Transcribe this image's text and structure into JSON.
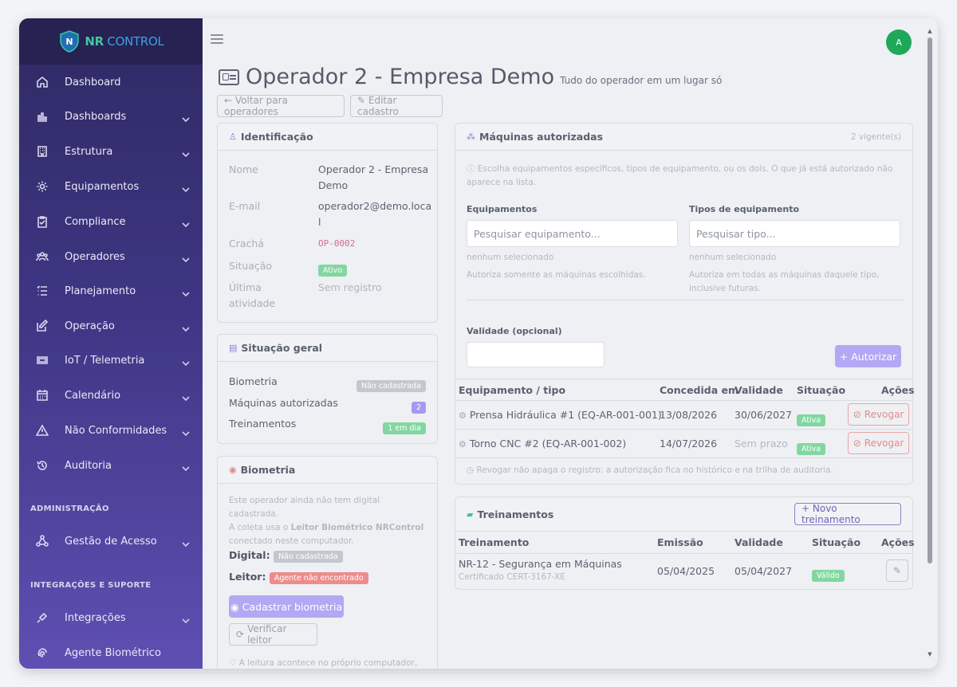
{
  "brand": {
    "nr": "NR",
    "control": "CONTROL"
  },
  "sidebar": {
    "items": [
      {
        "label": "Dashboard",
        "icon": "home-icon"
      },
      {
        "label": "Dashboards",
        "icon": "bar-chart-icon"
      },
      {
        "label": "Estrutura",
        "icon": "building-icon"
      },
      {
        "label": "Equipamentos",
        "icon": "gear-icon"
      },
      {
        "label": "Compliance",
        "icon": "clipboard-check-icon"
      },
      {
        "label": "Operadores",
        "icon": "people-icon"
      },
      {
        "label": "Planejamento",
        "icon": "list-icon"
      },
      {
        "label": "Operação",
        "icon": "edit-icon"
      },
      {
        "label": "IoT / Telemetria",
        "icon": "device-icon"
      },
      {
        "label": "Calendário",
        "icon": "calendar-icon"
      },
      {
        "label": "Não Conformidades",
        "icon": "warning-icon"
      },
      {
        "label": "Auditoria",
        "icon": "history-icon"
      }
    ],
    "section_admin": "ADMINISTRAÇÃO",
    "admin_items": [
      {
        "label": "Gestão de Acesso",
        "icon": "diagram-icon"
      }
    ],
    "section_integ": "INTEGRAÇÕES E SUPORTE",
    "integ_items": [
      {
        "label": "Integrações",
        "icon": "plug-icon"
      },
      {
        "label": "Agente Biométrico",
        "icon": "fingerprint-icon"
      }
    ]
  },
  "topbar": {
    "avatar": "A"
  },
  "page": {
    "title": "Operador 2 - Empresa Demo",
    "subtitle": "Tudo do operador em um lugar só",
    "back_button": "← Voltar para operadores",
    "edit_button": "✎ Editar cadastro"
  },
  "identificacao": {
    "title": "Identificação",
    "nome_label": "Nome",
    "nome_l1": "Operador 2 - Empresa",
    "nome_l2": "Demo",
    "email_label": "E-mail",
    "email_l1": "operador2@demo.loca",
    "email_l2": "l",
    "cracha_label": "Crachá",
    "cracha": "OP-0002",
    "situacao_label": "Situação",
    "situacao": "Ativo",
    "ultima_l1": "Última",
    "ultima_l2": "atividade",
    "ultima": "Sem registro"
  },
  "situacao_geral": {
    "title": "Situação geral",
    "rows": [
      {
        "label": "Biometria",
        "badge": "Não cadastrada"
      },
      {
        "label": "Máquinas autorizadas",
        "badge": "2"
      },
      {
        "label": "Treinamentos",
        "badge": "1 em dia"
      }
    ]
  },
  "biometria": {
    "title": "Biometria",
    "text_l1": "Este operador ainda não tem digital cadastrada.",
    "text_l2a": "A coleta usa o ",
    "text_l2b": "Leitor Biométrico NRControl",
    "text_l3": "conectado neste computador.",
    "digital_label": "Digital:",
    "digital_badge": "Não cadastrada",
    "leitor_label": "Leitor:",
    "leitor_badge": "Agente não encontrado",
    "cadastrar_button": "Cadastrar biometria",
    "verificar_button": "Verificar leitor",
    "footer": "♡ A leitura acontece no próprio computador,"
  },
  "maquinas": {
    "title": "Máquinas autorizadas",
    "count": "2 vigente(s)",
    "info_l1": "ⓘ Escolha equipamentos específicos, tipos de equipamento, ou os dois. O que já está autorizado não",
    "info_l2": "aparece na lista.",
    "equip_label": "Equipamentos",
    "equip_placeholder": "Pesquisar equipamento...",
    "equip_none": "nenhum selecionado",
    "equip_help": "Autoriza somente as máquinas escolhidas.",
    "tipos_label": "Tipos de equipamento",
    "tipos_placeholder": "Pesquisar tipo...",
    "tipos_none": "nenhum selecionado",
    "tipos_help_l1": "Autoriza em todas as máquinas daquele tipo,",
    "tipos_help_l2": "inclusive futuras.",
    "validade_label": "Validade (opcional)",
    "autorizar_button": "+ Autorizar",
    "columns": [
      "Equipamento / tipo",
      "Concedida em",
      "Validade",
      "Situação",
      "Ações"
    ],
    "rows": [
      {
        "equip": "Prensa Hidráulica #1 (EQ-AR-001-001)",
        "concedida": "13/08/2026",
        "validade": "30/06/2027",
        "situacao": "Ativa",
        "acao": "Revogar"
      },
      {
        "equip": "Torno CNC #2 (EQ-AR-001-002)",
        "concedida": "14/07/2026",
        "validade": "Sem prazo",
        "situacao": "Ativa",
        "acao": "Revogar"
      }
    ],
    "footer": "◷ Revogar não apaga o registro: a autorização fica no histórico e na trilha de auditoria."
  },
  "treinamentos": {
    "title": "Treinamentos",
    "novo_button": "+ Novo treinamento",
    "columns": [
      "Treinamento",
      "Emissão",
      "Validade",
      "Situação",
      "Ações"
    ],
    "rows": [
      {
        "nome": "NR-12 - Segurança em Máquinas",
        "cert": "Certificado CERT-3167-XE",
        "emissao": "05/04/2025",
        "validade": "05/04/2027",
        "situacao": "Válido"
      }
    ]
  },
  "colors": {
    "accent": "#b3a8f3",
    "success": "#82d7a0",
    "danger": "#ec8c8c",
    "sidebar_top": "#2e2a63",
    "sidebar_bottom": "#5e4fb2"
  }
}
